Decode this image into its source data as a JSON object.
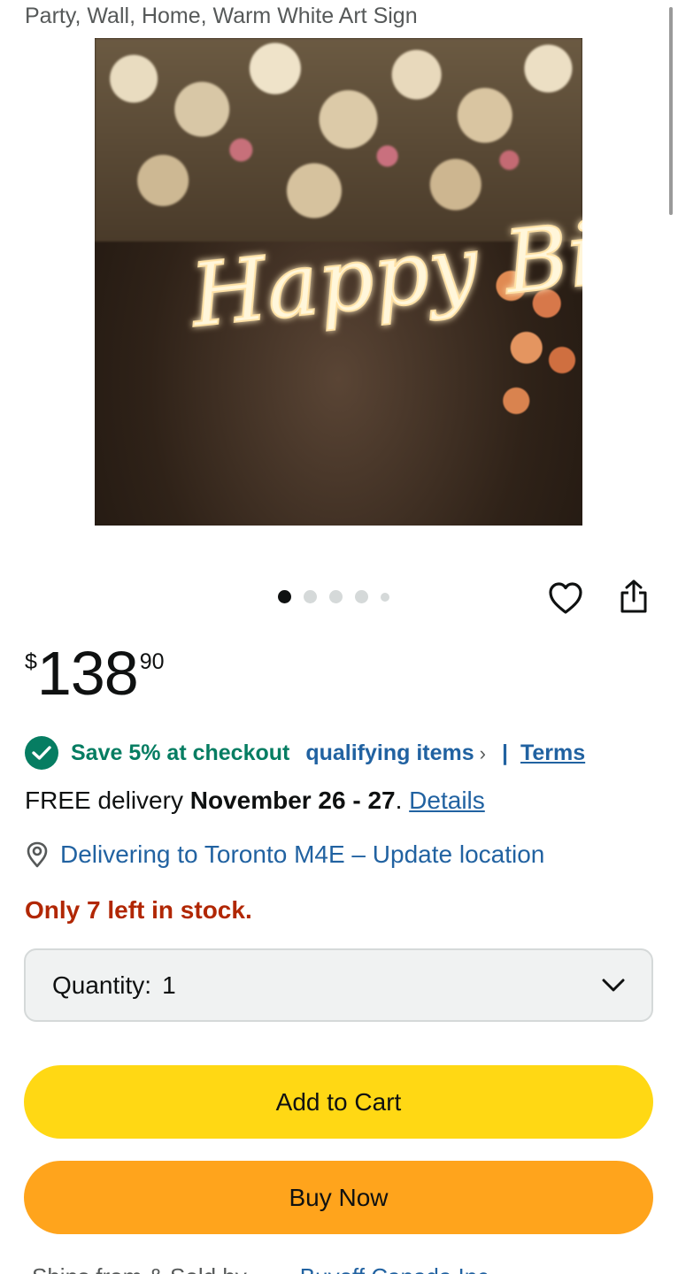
{
  "product": {
    "title_tail": "Party, Wall, Home, Warm White Art Sign",
    "image_text": "Happy Birthday",
    "image_count": 5,
    "active_image": 1
  },
  "icons": {
    "wishlist": "heart-icon",
    "share": "share-icon",
    "savings": "checkmark-circle-icon",
    "location": "location-pin-icon",
    "quantity": "chevron-down-icon"
  },
  "price": {
    "symbol": "$",
    "whole": "138",
    "fraction": "90"
  },
  "savings": {
    "text": "Save 5% at checkout",
    "qualifying": "qualifying items",
    "chevron": "›",
    "separator": "|",
    "terms": "Terms"
  },
  "delivery": {
    "prefix": "FREE delivery ",
    "dates": "November 26 - 27",
    "period": ". ",
    "details": "Details"
  },
  "location": {
    "text": "Delivering to Toronto M4E – Update location"
  },
  "stock": {
    "text": "Only 7 left in stock."
  },
  "quantity": {
    "label": "Quantity:",
    "value": "1"
  },
  "actions": {
    "add_to_cart": "Add to Cart",
    "buy_now": "Buy Now"
  },
  "footer": {
    "ships_from": "Ships from & Sold by",
    "seller": "Buyoff Canada Inc"
  },
  "colors": {
    "link": "#2162a1",
    "success": "#067d62",
    "stock_warning": "#b12704",
    "cart_button": "#ffd814",
    "buy_button": "#ffa41c"
  }
}
